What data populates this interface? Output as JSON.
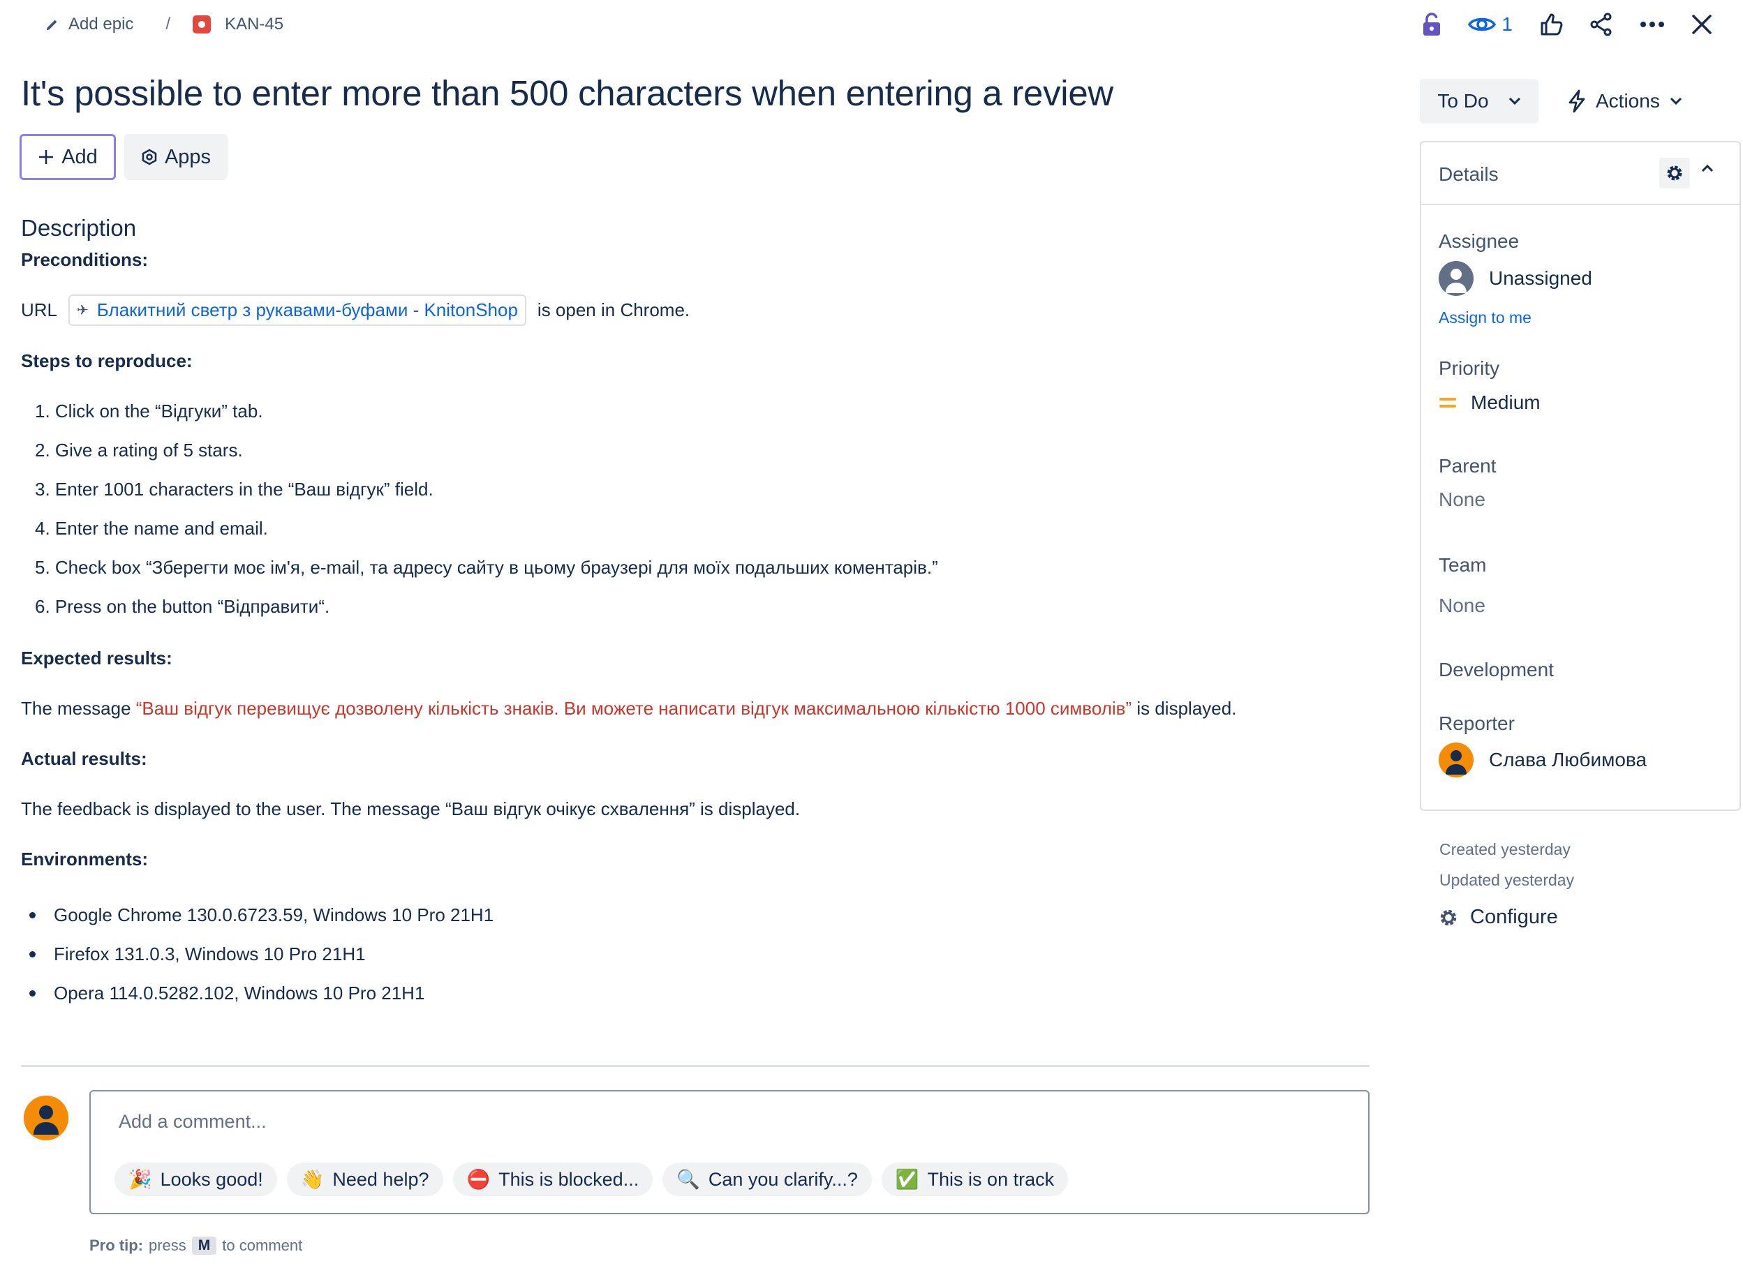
{
  "breadcrumb": {
    "add_epic": "Add epic",
    "separator": "/",
    "issue_key": "KAN-45"
  },
  "header_actions": {
    "watch_count": "1"
  },
  "issue": {
    "title": "It's possible to enter more than 500 characters when entering a review",
    "add_label": "Add",
    "apps_label": "Apps"
  },
  "description": {
    "heading": "Description",
    "preconditions_heading": "Preconditions:",
    "url_prefix": "URL",
    "url_link_text": "Блакитний светр з рукавами-буфами - KnitonShop",
    "url_suffix": "is open in Chrome.",
    "steps_heading": "Steps to reproduce:",
    "steps": [
      "1. Click on the “Відгуки” tab.",
      "2. Give a rating of 5 stars.",
      "3. Enter 1001 characters in the “Ваш відгук” field.",
      "4. Enter the name and email.",
      "5. Check box “Зберегти моє ім'я, e-mail, та адресу сайту в цьому браузері для моїх подальших коментарів.”",
      "6. Press on the button “Відправити“."
    ],
    "expected_heading": "Expected results:",
    "expected_prefix": "The message ",
    "expected_red": "“Ваш відгук перевищує дозволену кількість знаків. Ви можете написати відгук максимальною кількістю 1000 символів”",
    "expected_suffix": " is displayed.",
    "actual_heading": "Actual results:",
    "actual_text": "The feedback is displayed to the user. The message “Ваш відгук очікує схвалення” is displayed.",
    "environments_heading": "Environments:",
    "environments": [
      "Google Chrome 130.0.6723.59, Windows 10 Pro 21H1",
      "Firefox 131.0.3, Windows 10 Pro 21H1",
      "Opera 114.0.5282.102, Windows 10 Pro 21H1"
    ]
  },
  "comment": {
    "placeholder": "Add a comment...",
    "quick_replies": [
      {
        "emoji": "🎉",
        "label": "Looks good!"
      },
      {
        "emoji": "👋",
        "label": "Need help?"
      },
      {
        "emoji": "⛔",
        "label": "This is blocked..."
      },
      {
        "emoji": "🔍",
        "label": "Can you clarify...?"
      },
      {
        "emoji": "✅",
        "label": "This is on track"
      }
    ],
    "pro_tip_bold": "Pro tip:",
    "pro_tip_press": "press",
    "pro_tip_key": "M",
    "pro_tip_rest": "to comment"
  },
  "status": {
    "current": "To Do",
    "actions_label": "Actions"
  },
  "details": {
    "title": "Details",
    "assignee_label": "Assignee",
    "assignee_value": "Unassigned",
    "assign_to_me": "Assign to me",
    "priority_label": "Priority",
    "priority_value": "Medium",
    "parent_label": "Parent",
    "parent_value": "None",
    "team_label": "Team",
    "team_value": "None",
    "development_label": "Development",
    "reporter_label": "Reporter",
    "reporter_value": "Слава Любимова"
  },
  "meta": {
    "created": "Created yesterday",
    "updated": "Updated yesterday",
    "configure": "Configure"
  },
  "colors": {
    "accent": "#0c66e4",
    "error_text": "#c9372c",
    "avatar": "#f48c06",
    "priority_medium": "#f5a623"
  }
}
